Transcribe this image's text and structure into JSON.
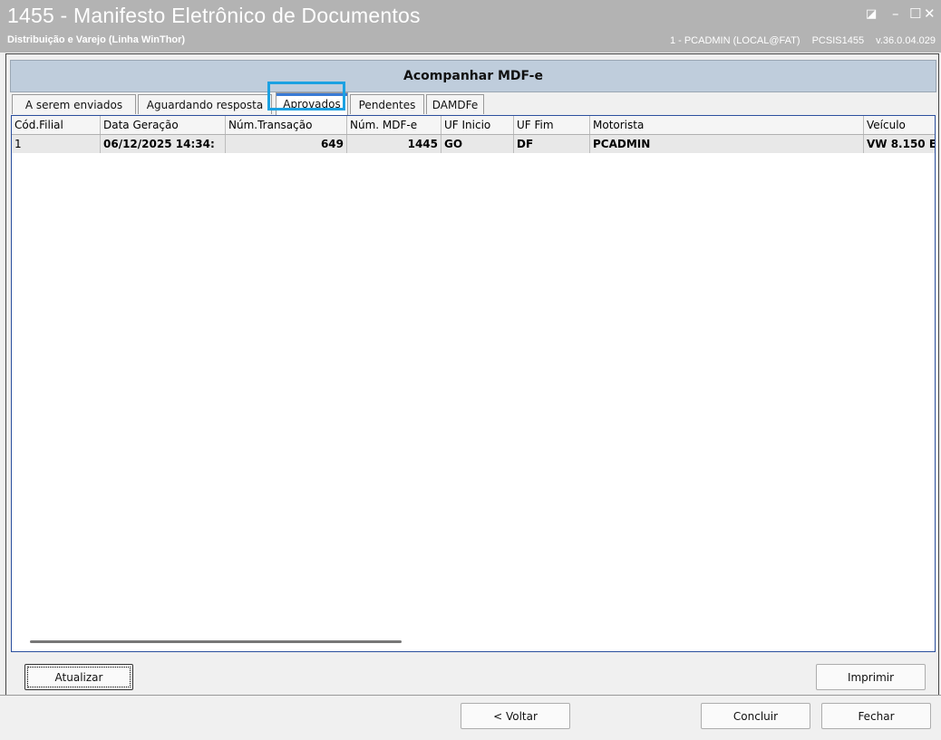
{
  "window": {
    "title": "1455 - Manifesto Eletrônico de Documentos",
    "subtitle": "Distribuição e Varejo (Linha WinThor)",
    "user": "1 - PCADMIN (LOCAL@FAT)",
    "routine": "PCSIS1455",
    "version": "v.36.0.04.029",
    "controls": {
      "edit": "◪",
      "minimize": "–",
      "maximize": "☐",
      "close": "✕"
    }
  },
  "panel": {
    "title": "Acompanhar MDF-e"
  },
  "tabs": [
    {
      "label": "A serem enviados"
    },
    {
      "label": "Aguardando resposta"
    },
    {
      "label": "Aprovados"
    },
    {
      "label": "Pendentes"
    },
    {
      "label": "DAMDFe"
    }
  ],
  "table": {
    "headers": [
      "Cód.Filial",
      "Data Geração",
      "Núm.Transação",
      "Núm. MDF-e",
      "UF Inicio",
      "UF Fim",
      "Motorista",
      "Veículo"
    ],
    "rows": [
      [
        "1",
        "06/12/2025 14:34:",
        "649",
        "1445",
        "GO",
        "DF",
        "PCADMIN",
        "VW 8.150 E"
      ]
    ]
  },
  "buttons": {
    "atualizar": "Atualizar",
    "imprimir": "Imprimir",
    "voltar": "< Voltar",
    "concluir": "Concluir",
    "fechar": "Fechar"
  },
  "colors": {
    "accent": "#1ba1e2",
    "header_bg": "#bfcddc",
    "titlebar": "#b3b3b3"
  }
}
